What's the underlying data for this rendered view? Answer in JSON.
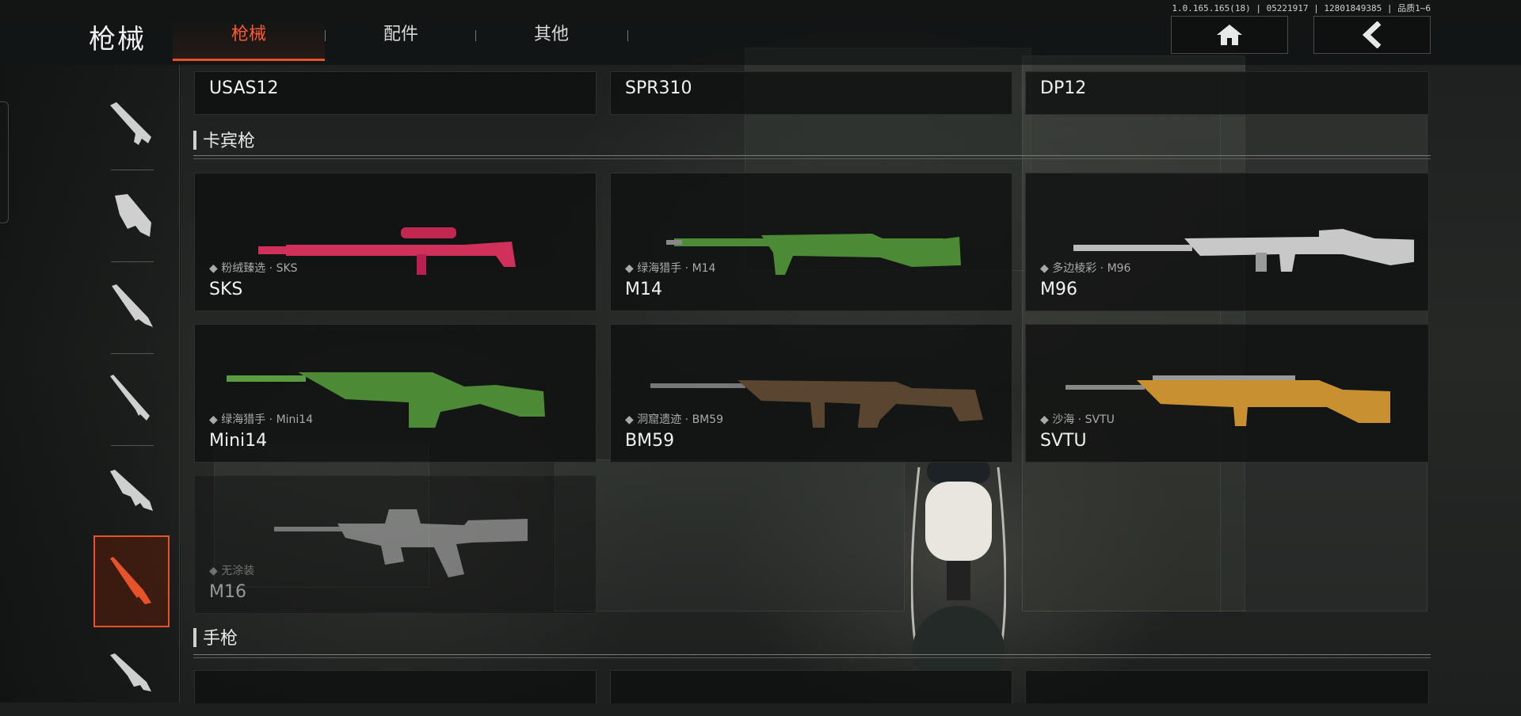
{
  "header": {
    "title": "枪械",
    "tabs": [
      {
        "label": "枪械",
        "active": true
      },
      {
        "label": "配件",
        "active": false
      },
      {
        "label": "其他",
        "active": false
      }
    ],
    "version": "1.0.165.165(18) | 05221917 | 12801849385 | 品质1~6",
    "home_icon": "home-icon",
    "back_icon": "chevron-left-icon"
  },
  "sidebar": {
    "items": [
      {
        "icon": "assault-rifle-icon",
        "active": false
      },
      {
        "icon": "smg-icon",
        "active": false
      },
      {
        "icon": "shotgun-icon",
        "active": false
      },
      {
        "icon": "sniper-rifle-icon",
        "active": false
      },
      {
        "icon": "lmg-icon",
        "active": false
      },
      {
        "icon": "carbine-icon",
        "active": true
      },
      {
        "icon": "pistol-icon",
        "active": false
      }
    ]
  },
  "content": {
    "top_row": [
      "USAS12",
      "SPR310",
      "DP12"
    ],
    "sections": [
      {
        "title": "卡宾枪",
        "items": [
          {
            "name": "SKS",
            "skin": "粉绒臻选 · SKS",
            "color": "#d0305a"
          },
          {
            "name": "M14",
            "skin": "绿海猎手 · M14",
            "color": "#4c8a36"
          },
          {
            "name": "M96",
            "skin": "多边棱彩 · M96",
            "color": "#c8c8c8"
          },
          {
            "name": "Mini14",
            "skin": "绿海猎手 · Mini14",
            "color": "#4c8a36"
          },
          {
            "name": "BM59",
            "skin": "洞窟遗迹 · BM59",
            "color": "#5a4530"
          },
          {
            "name": "SVTU",
            "skin": "沙海 · SVTU",
            "color": "#c89030"
          },
          {
            "name": "M16",
            "skin": "无涂装",
            "color": "#9a9a9a",
            "locked": true
          }
        ]
      },
      {
        "title": "手枪",
        "items": []
      }
    ]
  },
  "colors": {
    "accent": "#e8522a",
    "text": "#e6e6e6",
    "muted": "#a9a9a9"
  }
}
